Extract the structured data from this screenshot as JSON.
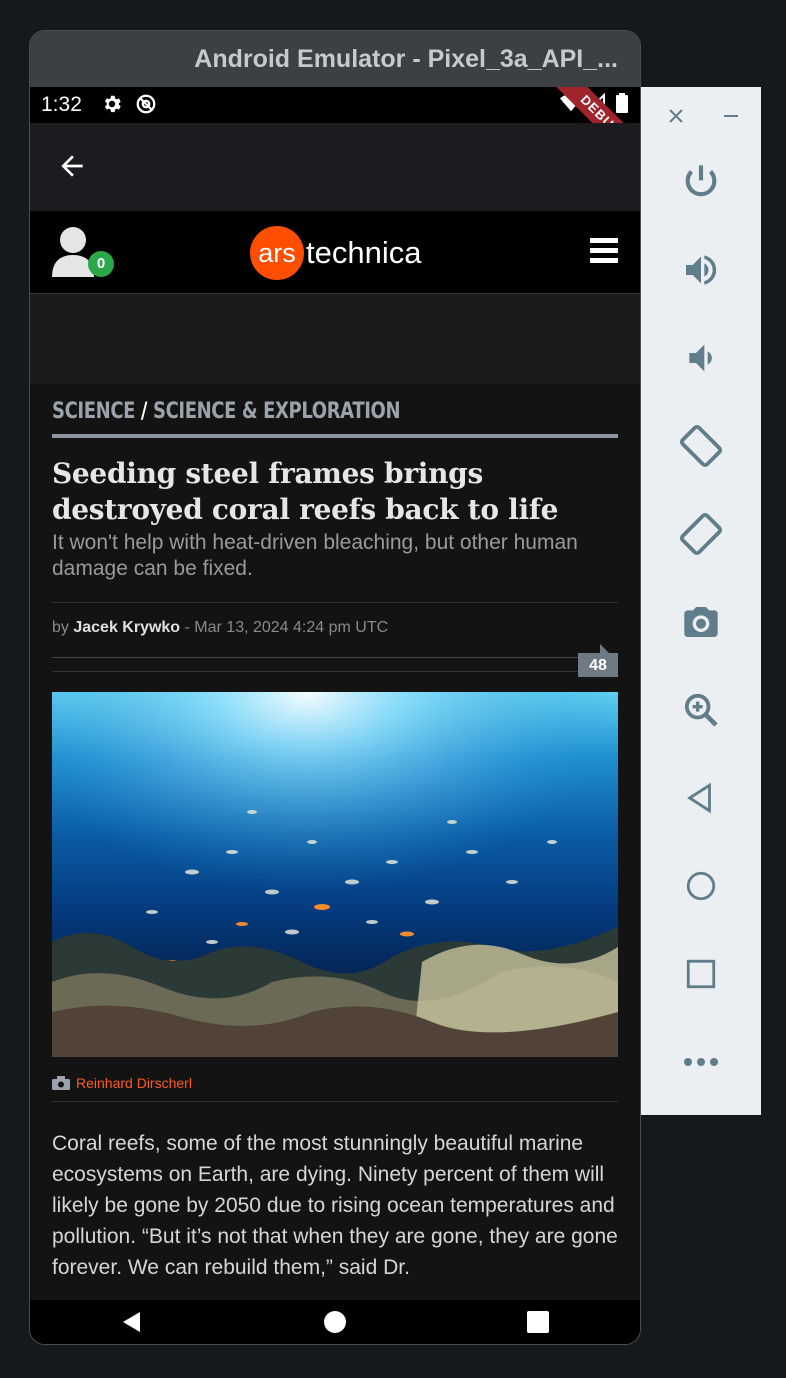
{
  "window": {
    "title": "Android Emulator - Pixel_3a_API_..."
  },
  "statusbar": {
    "time": "1:32",
    "debug_label": "DEBUG"
  },
  "header": {
    "logo_ars": "ars",
    "logo_technica": "technica",
    "notification_count": "0"
  },
  "article": {
    "category": "SCIENCE",
    "separator": " / ",
    "subcategory": "SCIENCE & EXPLORATION",
    "title": "Seeding steel frames brings destroyed coral reefs back to life",
    "subtitle": "It won't help with heat-driven bleaching, but other human damage can be fixed.",
    "by": "by ",
    "author": "Jacek Krywko",
    "date": " - Mar 13, 2024 4:24 pm UTC",
    "comment_count": "48",
    "photo_credit": "Reinhard Dirscherl",
    "body": "Coral reefs, some of the most stunningly beautiful marine ecosystems on Earth, are dying. Ninety percent of them will likely be gone by 2050 due to rising ocean temperatures and pollution. “But it’s not that when they are gone, they are gone forever. We can rebuild them,” said Dr."
  },
  "colors": {
    "accent": "#ff4e00",
    "badge": "#2aa84a",
    "debug": "#a1242c"
  },
  "side_panel": {
    "icons": [
      "close-icon",
      "minimize-icon",
      "power-icon",
      "volume-up-icon",
      "volume-down-icon",
      "rotate-left-icon",
      "rotate-right-icon",
      "camera-icon",
      "zoom-icon",
      "back-icon",
      "home-icon",
      "overview-icon",
      "more-icon"
    ]
  }
}
